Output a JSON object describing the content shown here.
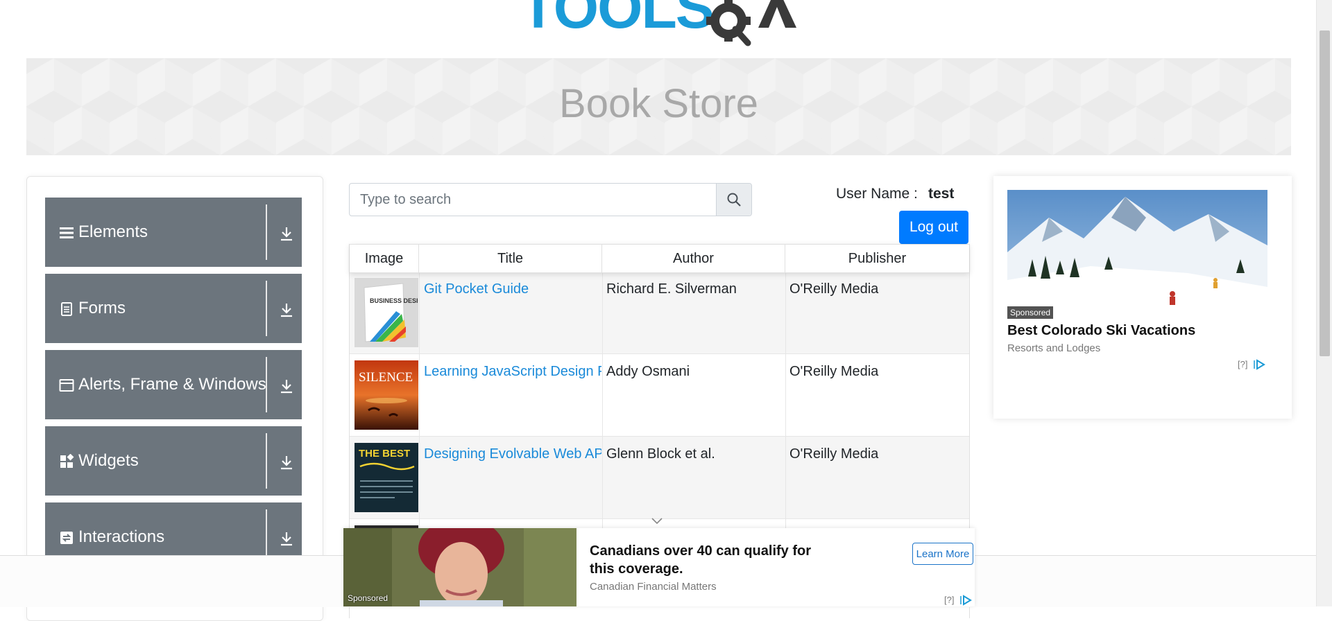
{
  "header": {
    "logo_text": "TOOLSQA",
    "page_title": "Book Store"
  },
  "sidebar": {
    "groups": [
      {
        "label": "Elements",
        "icon": "hamburger-icon"
      },
      {
        "label": "Forms",
        "icon": "document-icon"
      },
      {
        "label": "Alerts, Frame & Windows",
        "icon": "window-icon"
      },
      {
        "label": "Widgets",
        "icon": "widgets-icon"
      },
      {
        "label": "Interactions",
        "icon": "interactions-icon"
      }
    ]
  },
  "search": {
    "placeholder": "Type to search",
    "value": ""
  },
  "user": {
    "label": "User Name :",
    "value": "test",
    "logout_label": "Log out"
  },
  "table": {
    "headers": [
      "Image",
      "Title",
      "Author",
      "Publisher"
    ],
    "rows": [
      {
        "title": "Git Pocket Guide",
        "author": "Richard E. Silverman",
        "publisher": "O'Reilly Media",
        "cover_text": "BUSINESS DESIGN"
      },
      {
        "title": "Learning JavaScript Design Patterns",
        "author": "Addy Osmani",
        "publisher": "O'Reilly Media",
        "cover_text": "SILENCE"
      },
      {
        "title": "Designing Evolvable Web APIs with ASP.NET",
        "author": "Glenn Block et al.",
        "publisher": "O'Reilly Media",
        "cover_text": "THE BEST"
      }
    ]
  },
  "ad_right": {
    "sponsored": "Sponsored",
    "title": "Best Colorado Ski Vacations",
    "subtitle": "Resorts and Lodges",
    "mark": "[?]"
  },
  "ad_bottom": {
    "sponsored": "Sponsored",
    "title": "Canadians over 40 can qualify for this coverage.",
    "subtitle": "Canadian Financial Matters",
    "cta": "Learn More",
    "mark": "[?]"
  },
  "colors": {
    "accent": "#007bff",
    "sidebar_group": "#6c757d",
    "link": "#1a8ad9",
    "logo_blue": "#1b9bd8",
    "logo_dark": "#3a3a3a"
  }
}
